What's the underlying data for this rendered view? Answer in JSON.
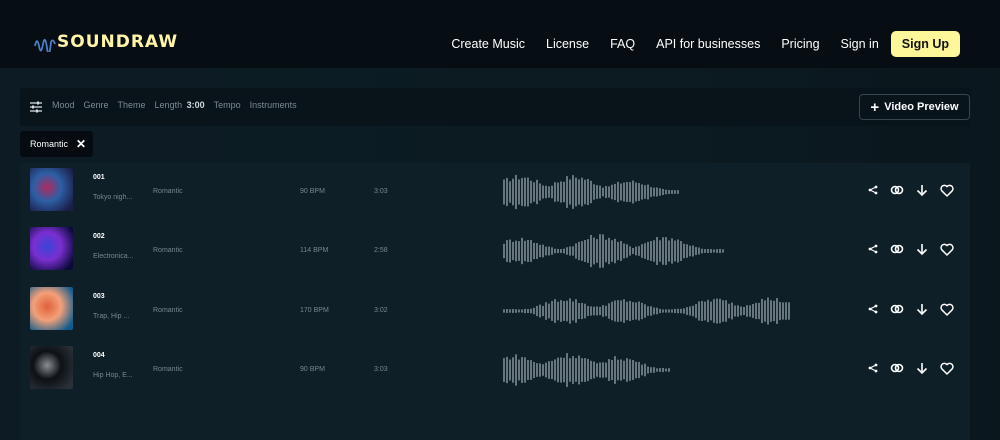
{
  "brand": {
    "name": "SOUNDRAW",
    "accent": "#fdf79a",
    "logo_wave_color": "#4a7ec8"
  },
  "nav": {
    "items": [
      "Create Music",
      "License",
      "FAQ",
      "API for businesses",
      "Pricing",
      "Sign in"
    ],
    "signup_label": "Sign Up"
  },
  "filters": {
    "icon": "sliders-icon",
    "items": [
      "Mood",
      "Genre",
      "Theme"
    ],
    "length_label": "Length",
    "length_value": "3:00",
    "tempo_label": "Tempo",
    "instruments_label": "Instruments",
    "video_preview_label": "Video Preview",
    "active_chip": "Romantic"
  },
  "tracks": [
    {
      "number": "001",
      "genre": "Tokyo nigh...",
      "mood": "Romantic",
      "bpm": "90 BPM",
      "duration": "3:03",
      "thumb_colors": [
        "#1b1f4a",
        "#b0295f",
        "#2d5fa5"
      ]
    },
    {
      "number": "002",
      "genre": "Electronica...",
      "mood": "Romantic",
      "bpm": "114 BPM",
      "duration": "2:58",
      "thumb_colors": [
        "#0a0a3a",
        "#3a44d8",
        "#7a2fd0"
      ]
    },
    {
      "number": "003",
      "genre": "Trap, Hip ...",
      "mood": "Romantic",
      "bpm": "170 BPM",
      "duration": "3:02",
      "thumb_colors": [
        "#0f5c8c",
        "#e0603a",
        "#f3a07a"
      ]
    },
    {
      "number": "004",
      "genre": "Hip Hop, E...",
      "mood": "Romantic",
      "bpm": "90 BPM",
      "duration": "3:03",
      "thumb_colors": [
        "#2b3038",
        "#8a8f96",
        "#0d1116"
      ]
    }
  ],
  "track_actions": [
    "share-icon",
    "link-icon",
    "download-icon",
    "heart-icon"
  ]
}
